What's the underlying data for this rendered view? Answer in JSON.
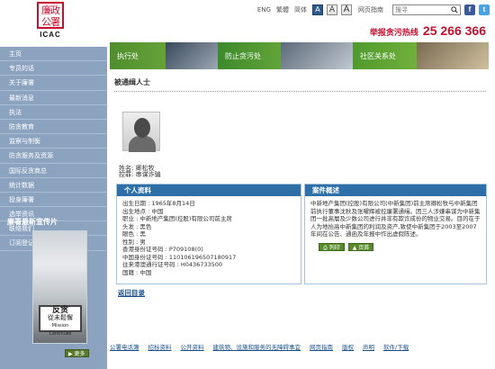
{
  "brand": {
    "seal_text": "廉政公署",
    "mark": "ICAC"
  },
  "topbar": {
    "languages": [
      "ENG",
      "繁體",
      "简体"
    ],
    "font_sizes": [
      "A",
      "A",
      "A"
    ],
    "accessibility": "网页指南",
    "search_placeholder": "搜寻"
  },
  "hotline": {
    "label": "举报贪污热线",
    "number": "25 266 366"
  },
  "nav": [
    "主页",
    "专员的话",
    "关于廉署",
    "最新消息",
    "执法",
    "防贪教育",
    "监察与制衡",
    "防贪服务及资源",
    "国际反贪商总",
    "统计数据",
    "投身廉署",
    "选举资讯",
    "联络我们",
    "订阅登记"
  ],
  "promo": {
    "title": "廉署最新宣传片",
    "sign_line1": "反贪",
    "sign_line2": "從未鬆懈",
    "sign_line3": "Mission Continues",
    "more": "更多"
  },
  "banner": {
    "exec": "执行处",
    "prev": "防止贪污处",
    "comm": "社区关系处"
  },
  "page": {
    "title": "被通缉人士",
    "name_label": "姓名:",
    "name": "卿松牧",
    "offense_label": "控罪:",
    "offense": "串谋诈骗"
  },
  "info_card": {
    "header": "个人资料",
    "rows": [
      "出生日期 : 1965年8月14日",
      "出生地点 : 中国",
      "职业 : 中新地产集团(控股)有限公司前主席",
      "头发 : 黑色",
      "眼色 : 黑",
      "性别 : 男",
      "香港身份证号码 : P709108(0)",
      "中国身份证号码 : 110106196507180917",
      "往来港澳通行证号码 : H0436733500",
      "国籍 : 中国"
    ]
  },
  "case_card": {
    "header": "案件概述",
    "text": "中新地产集团(控股)有限公司(中新集团)前主席卿松牧与中新集团前执行董事沈秋及张曜辉被控廉署通缉。因三人涉嫌串谋为中新集团一批高層及少数公司进行并非有欺诈成份的物业交易。目的在于人为地抬高中新集团的利润及资产,致使中新集团于2003至2007年间在公告、通函及年报中作出虚假陈述。"
  },
  "back_link": "返回目录",
  "actions": {
    "print": "列印",
    "top": "页首"
  },
  "footer": {
    "links": [
      "公署电话簿",
      "招标资料",
      "公开资料",
      "建筑物、设施和服务的无障碍事宜",
      "网页指南",
      "版权",
      "声明",
      "软件/下载"
    ]
  }
}
